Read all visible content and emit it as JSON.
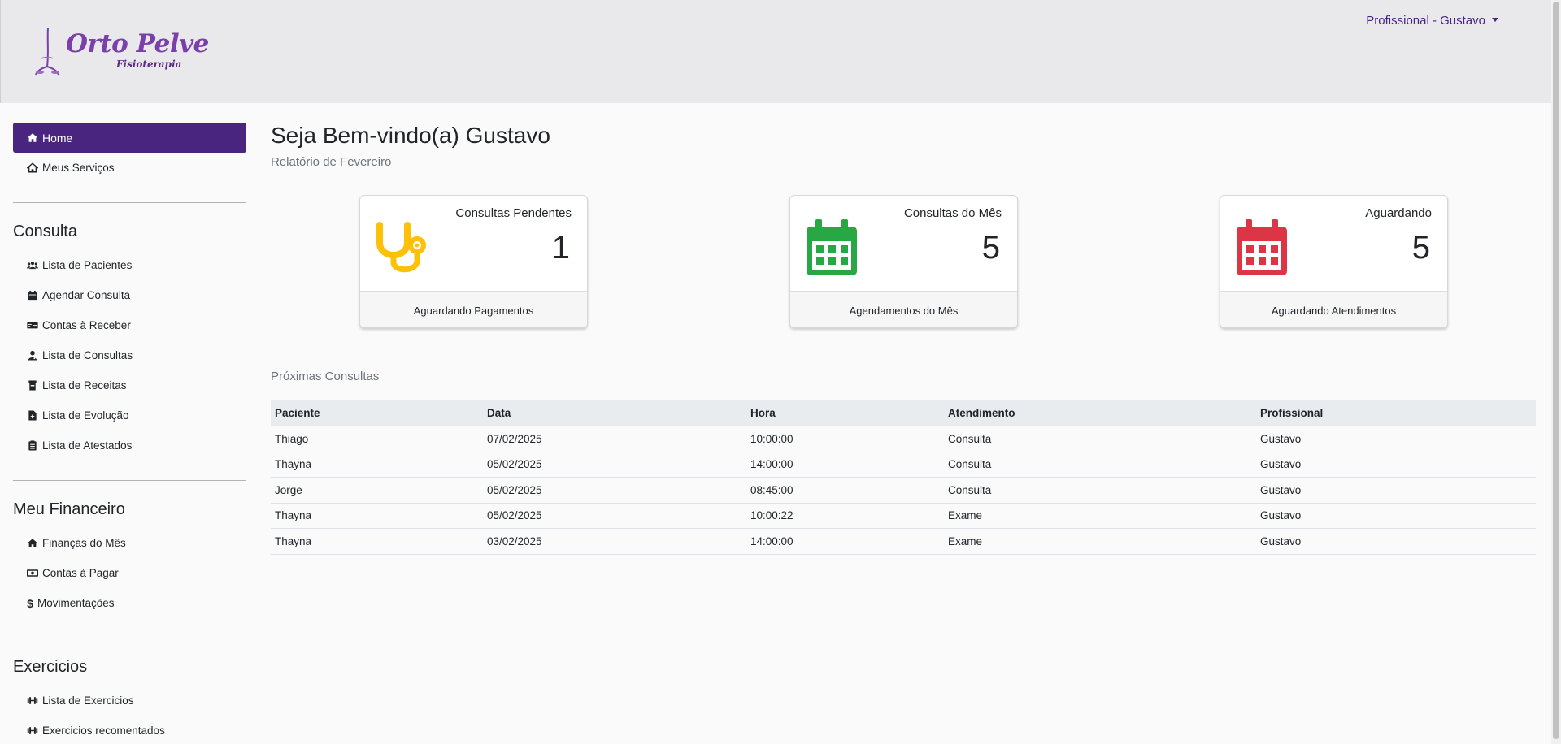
{
  "header": {
    "logo_title": "Orto Pelve",
    "logo_subtitle": "Fisioterapia",
    "user_menu": "Profissional - Gustavo"
  },
  "sidebar": {
    "top_items": [
      {
        "label": "Home",
        "icon": "home-icon",
        "active": true
      },
      {
        "label": "Meus Serviços",
        "icon": "house-outline-icon",
        "active": false
      }
    ],
    "sections": [
      {
        "title": "Consulta",
        "items": [
          {
            "label": "Lista de Pacientes",
            "icon": "users-icon"
          },
          {
            "label": "Agendar Consulta",
            "icon": "calendar-icon"
          },
          {
            "label": "Contas à Receber",
            "icon": "money-check-icon"
          },
          {
            "label": "Lista de Consultas",
            "icon": "user-doctor-icon"
          },
          {
            "label": "Lista de Receitas",
            "icon": "prescription-bottle-icon"
          },
          {
            "label": "Lista de Evolução",
            "icon": "file-medical-icon"
          },
          {
            "label": "Lista de Atestados",
            "icon": "clipboard-list-icon"
          }
        ]
      },
      {
        "title": "Meu Financeiro",
        "items": [
          {
            "label": "Finanças do Mês",
            "icon": "home-icon"
          },
          {
            "label": "Contas à Pagar",
            "icon": "money-bill-icon"
          },
          {
            "label": "Movimentações",
            "icon": "dollar-icon"
          }
        ]
      },
      {
        "title": "Exercicios",
        "items": [
          {
            "label": "Lista de Exercicios",
            "icon": "dumbbell-icon"
          },
          {
            "label": "Exercicios recomentados",
            "icon": "dumbbell-icon"
          }
        ]
      }
    ]
  },
  "main": {
    "welcome": "Seja Bem-vindo(a) Gustavo",
    "subtitle": "Relatório de Fevereiro",
    "cards": [
      {
        "label": "Consultas Pendentes",
        "value": "1",
        "footer": "Aguardando Pagamentos",
        "icon": "stethoscope-icon",
        "color": "#ffc107"
      },
      {
        "label": "Consultas do Mês",
        "value": "5",
        "footer": "Agendamentos do Mês",
        "icon": "calendar-icon",
        "color": "#28a745"
      },
      {
        "label": "Aguardando",
        "value": "5",
        "footer": "Aguardando Atendimentos",
        "icon": "calendar-icon",
        "color": "#dc3545"
      }
    ],
    "upcoming_title": "Próximas Consultas",
    "table": {
      "headers": [
        "Paciente",
        "Data",
        "Hora",
        "Atendimento",
        "Profissional"
      ],
      "rows": [
        [
          "Thiago",
          "07/02/2025",
          "10:00:00",
          "Consulta",
          "Gustavo"
        ],
        [
          "Thayna",
          "05/02/2025",
          "14:00:00",
          "Consulta",
          "Gustavo"
        ],
        [
          "Jorge",
          "05/02/2025",
          "08:45:00",
          "Consulta",
          "Gustavo"
        ],
        [
          "Thayna",
          "05/02/2025",
          "10:00:22",
          "Exame",
          "Gustavo"
        ],
        [
          "Thayna",
          "03/02/2025",
          "14:00:00",
          "Exame",
          "Gustavo"
        ]
      ]
    }
  }
}
